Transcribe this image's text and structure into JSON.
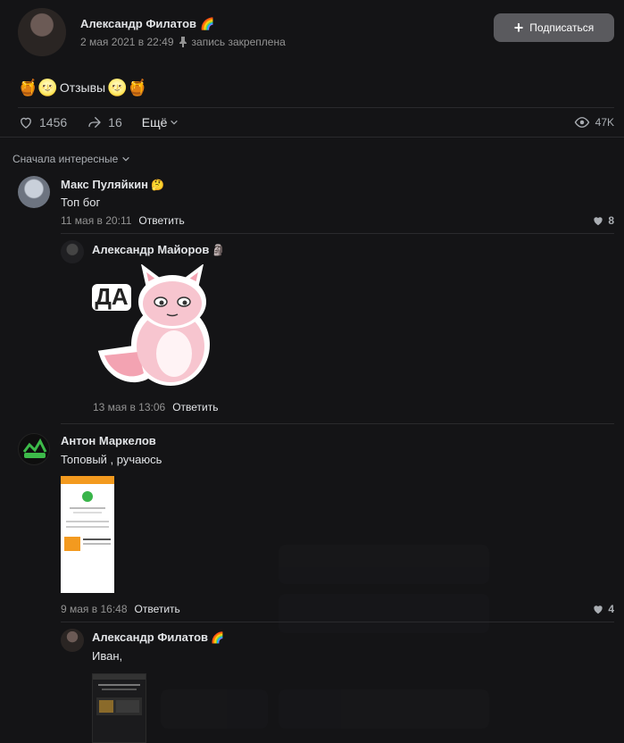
{
  "post": {
    "author": "Александр Филатов",
    "author_emoji": "🌈",
    "date": "2 мая 2021 в 22:49",
    "pinned_label": "запись закреплена",
    "subscribe_label": "Подписаться",
    "text_prefix": "🍯🌝",
    "text": "Отзывы",
    "text_suffix": "🌝🍯",
    "likes": "1456",
    "shares": "16",
    "more_label": "Ещё",
    "views": "47K"
  },
  "sort_label": "Сначала интересные",
  "comments": [
    {
      "author": "Макс Пуляйкин",
      "emoji": "🤔",
      "text": "Топ бог",
      "date": "11 мая в 20:11",
      "reply_label": "Ответить",
      "likes": "8"
    },
    {
      "author": "Александр Майоров",
      "emoji": "🗿",
      "sticker_text": "ДА",
      "date": "13 мая в 13:06",
      "reply_label": "Ответить"
    },
    {
      "author": "Антон Маркелов",
      "text": "Топовый , ручаюсь",
      "date": "9 мая в 16:48",
      "reply_label": "Ответить",
      "likes": "4"
    },
    {
      "author": "Александр Филатов",
      "emoji": "🌈",
      "text": "Иван,"
    }
  ],
  "colors": {
    "background": "#141416",
    "text": "#e1e3e6",
    "muted": "#939393",
    "button": "#5a5a5e"
  }
}
